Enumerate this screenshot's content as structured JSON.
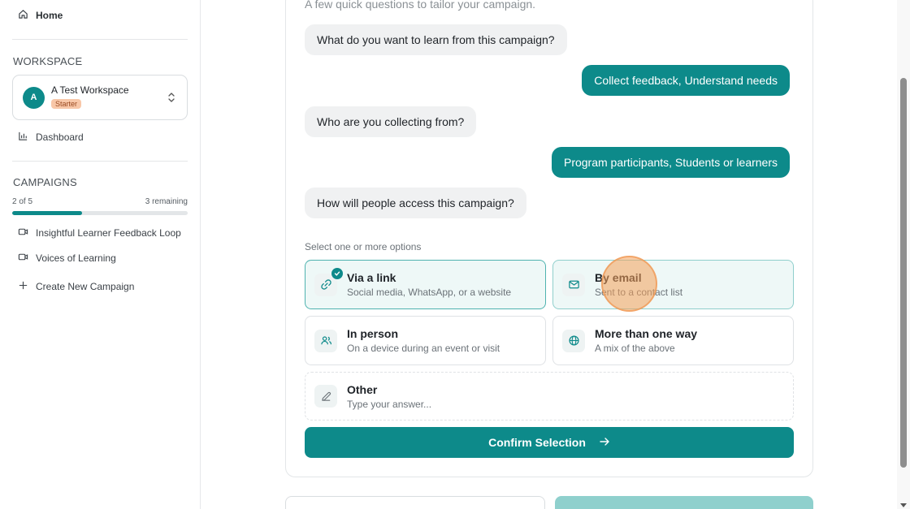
{
  "sidebar": {
    "home_label": "Home",
    "workspace_title": "WORKSPACE",
    "workspace": {
      "avatar_letter": "A",
      "name": "A Test Workspace",
      "plan": "Starter"
    },
    "dashboard_label": "Dashboard",
    "campaigns_title": "CAMPAIGNS",
    "campaigns_count": "2 of 5",
    "campaigns_remaining": "3 remaining",
    "campaigns_progress_percent": 40,
    "campaigns": [
      {
        "label": "Insightful Learner Feedback Loop",
        "icon": "video-icon"
      },
      {
        "label": "Voices of Learning",
        "icon": "video-icon"
      }
    ],
    "create_label": "Create New Campaign"
  },
  "main": {
    "subtitle": "A few quick questions to tailor your campaign.",
    "chat": [
      {
        "role": "question",
        "text": "What do you want to learn from this campaign?"
      },
      {
        "role": "answer",
        "text": "Collect feedback, Understand needs"
      },
      {
        "role": "question",
        "text": "Who are you collecting from?"
      },
      {
        "role": "answer",
        "text": "Program participants, Students or learners"
      },
      {
        "role": "question",
        "text": "How will people access this campaign?"
      }
    ],
    "select_label": "Select one or more options",
    "options": [
      {
        "title": "Via a link",
        "desc": "Social media, WhatsApp, or a website",
        "icon": "link-icon",
        "selected": true
      },
      {
        "title": "By email",
        "desc": "Sent to a contact list",
        "icon": "mail-icon",
        "selected": true
      },
      {
        "title": "In person",
        "desc": "On a device during an event or visit",
        "icon": "users-icon",
        "selected": false
      },
      {
        "title": "More than one way",
        "desc": "A mix of the above",
        "icon": "globe-icon",
        "selected": false
      },
      {
        "title": "Other",
        "desc": "Type your answer...",
        "icon": "pencil-icon",
        "selected": false
      }
    ],
    "confirm_label": "Confirm Selection"
  },
  "colors": {
    "accent": "#0d8a8a",
    "badge": "#f8c7a8"
  }
}
